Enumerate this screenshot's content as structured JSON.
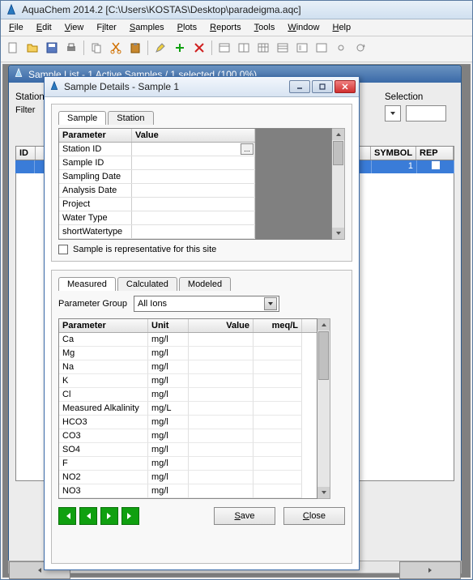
{
  "app": {
    "title": "AquaChem 2014.2 [C:\\Users\\KOSTAS\\Desktop\\paradeigma.aqc]"
  },
  "menu": {
    "file": "File",
    "edit": "Edit",
    "view": "View",
    "filter": "Filter",
    "samples": "Samples",
    "plots": "Plots",
    "reports": "Reports",
    "tools": "Tools",
    "window": "Window",
    "help": "Help"
  },
  "mdi": {
    "title": "Sample List - 1 Active Samples / 1 selected (100,0%)",
    "station_label": "Station",
    "selection_label": "Selection",
    "filter_label": "Filter",
    "columns": {
      "id": "ID",
      "symbol": "SYMBOL",
      "rep": "REP"
    },
    "row": {
      "symbol": "1",
      "rep_checked": false
    }
  },
  "modal": {
    "title": "Sample Details - Sample 1",
    "tabs": {
      "sample": "Sample",
      "station": "Station"
    },
    "param_table": {
      "headers": {
        "parameter": "Parameter",
        "value": "Value"
      },
      "rows": [
        {
          "parameter": "Station ID",
          "value": ""
        },
        {
          "parameter": "Sample ID",
          "value": ""
        },
        {
          "parameter": "Sampling Date",
          "value": ""
        },
        {
          "parameter": "Analysis Date",
          "value": ""
        },
        {
          "parameter": "Project",
          "value": ""
        },
        {
          "parameter": "Water Type",
          "value": ""
        },
        {
          "parameter": "shortWatertype",
          "value": ""
        }
      ]
    },
    "rep_check_label": "Sample is representative for this site",
    "measured_tabs": {
      "measured": "Measured",
      "calculated": "Calculated",
      "modeled": "Modeled"
    },
    "param_group_label": "Parameter Group",
    "param_group_value": "All Ions",
    "data_table": {
      "headers": {
        "parameter": "Parameter",
        "unit": "Unit",
        "value": "Value",
        "meq": "meq/L"
      },
      "rows": [
        {
          "parameter": "Ca",
          "unit": "mg/l"
        },
        {
          "parameter": "Mg",
          "unit": "mg/l"
        },
        {
          "parameter": "Na",
          "unit": "mg/l"
        },
        {
          "parameter": "K",
          "unit": "mg/l"
        },
        {
          "parameter": "Cl",
          "unit": "mg/l"
        },
        {
          "parameter": "Measured Alkalinity",
          "unit": "mg/L"
        },
        {
          "parameter": "HCO3",
          "unit": "mg/l"
        },
        {
          "parameter": "CO3",
          "unit": "mg/l"
        },
        {
          "parameter": "SO4",
          "unit": "mg/l"
        },
        {
          "parameter": "F",
          "unit": "mg/l"
        },
        {
          "parameter": "NO2",
          "unit": "mg/l"
        },
        {
          "parameter": "NO3",
          "unit": "mg/l"
        }
      ]
    },
    "buttons": {
      "save": "Save",
      "close": "Close"
    }
  }
}
